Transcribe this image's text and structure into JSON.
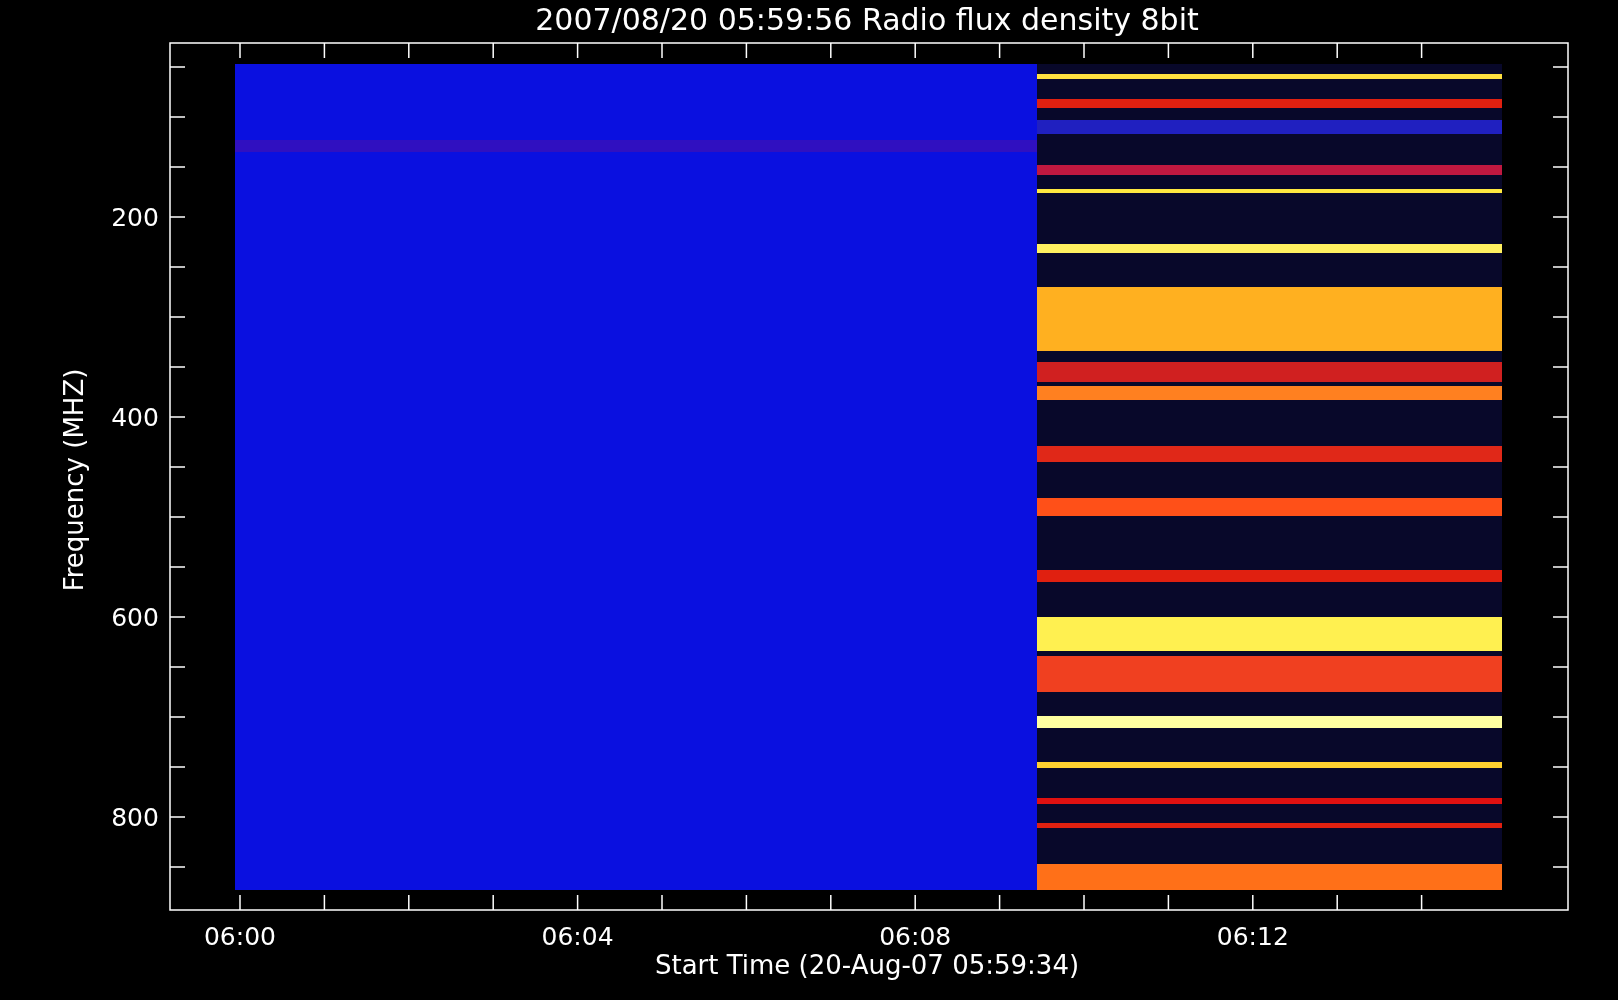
{
  "title": "2007/08/20 05:59:56 Radio flux density 8bit",
  "y_axis": {
    "label": "Frequency (MHZ)",
    "ticks": [
      "200",
      "400",
      "600",
      "800"
    ]
  },
  "x_axis": {
    "label": "Start Time (20-Aug-07 05:59:34)",
    "ticks": [
      "06:00",
      "06:04",
      "06:08",
      "06:12"
    ]
  }
}
